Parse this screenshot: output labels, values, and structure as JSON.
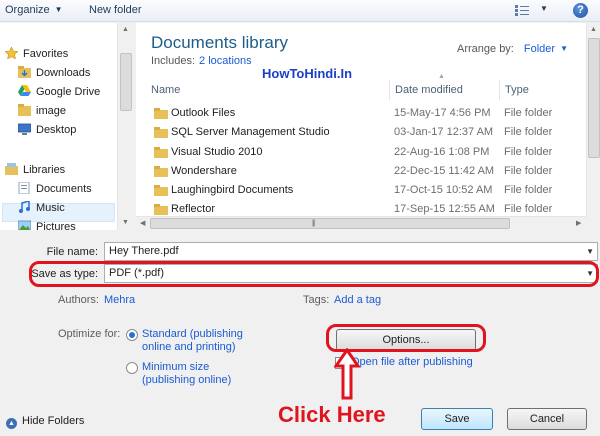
{
  "toolbar": {
    "organize": "Organize",
    "new_folder": "New folder",
    "help": "?"
  },
  "nav": {
    "favorites_label": "Favorites",
    "favorites": [
      "Downloads",
      "Google Drive",
      "image",
      "Desktop"
    ],
    "libraries_label": "Libraries",
    "libraries": [
      "Documents",
      "Music",
      "Pictures"
    ],
    "selected": "Documents"
  },
  "library": {
    "title": "Documents library",
    "includes_label": "Includes:",
    "includes_link": "2 locations",
    "arrange_label": "Arrange by:",
    "arrange_value": "Folder"
  },
  "watermark": "HowToHindi.In",
  "columns": {
    "name": "Name",
    "date": "Date modified",
    "type": "Type"
  },
  "files": [
    {
      "name": "Outlook Files",
      "date": "15-May-17 4:56 PM",
      "type": "File folder"
    },
    {
      "name": "SQL Server Management Studio",
      "date": "03-Jan-17 12:37 AM",
      "type": "File folder"
    },
    {
      "name": "Visual Studio 2010",
      "date": "22-Aug-16 1:08 PM",
      "type": "File folder"
    },
    {
      "name": "Wondershare",
      "date": "22-Dec-15 11:42 AM",
      "type": "File folder"
    },
    {
      "name": "Laughingbird Documents",
      "date": "17-Oct-15 10:52 AM",
      "type": "File folder"
    },
    {
      "name": "Reflector",
      "date": "17-Sep-15 12:55 AM",
      "type": "File folder"
    }
  ],
  "form": {
    "file_name_label": "File name:",
    "file_name_value": "Hey There.pdf",
    "save_type_label": "Save as type:",
    "save_type_value": "PDF (*.pdf)",
    "authors_label": "Authors:",
    "authors_value": "Mehra",
    "tags_label": "Tags:",
    "tags_value": "Add a tag",
    "optimize_label": "Optimize for:",
    "optimize_standard_line1": "Standard (publishing",
    "optimize_standard_line2": "online and printing)",
    "optimize_minimum_line1": "Minimum size",
    "optimize_minimum_line2": "(publishing online)",
    "options_button": "Options...",
    "open_after_label": "Open file after publishing"
  },
  "footer": {
    "hide_folders": "Hide Folders",
    "save": "Save",
    "cancel": "Cancel"
  },
  "annotation": {
    "text": "Click Here",
    "color": "#e0141e"
  },
  "colors": {
    "accent": "#1a5bd4",
    "title": "#1e5d8a",
    "selection": "#e5f1fb"
  }
}
